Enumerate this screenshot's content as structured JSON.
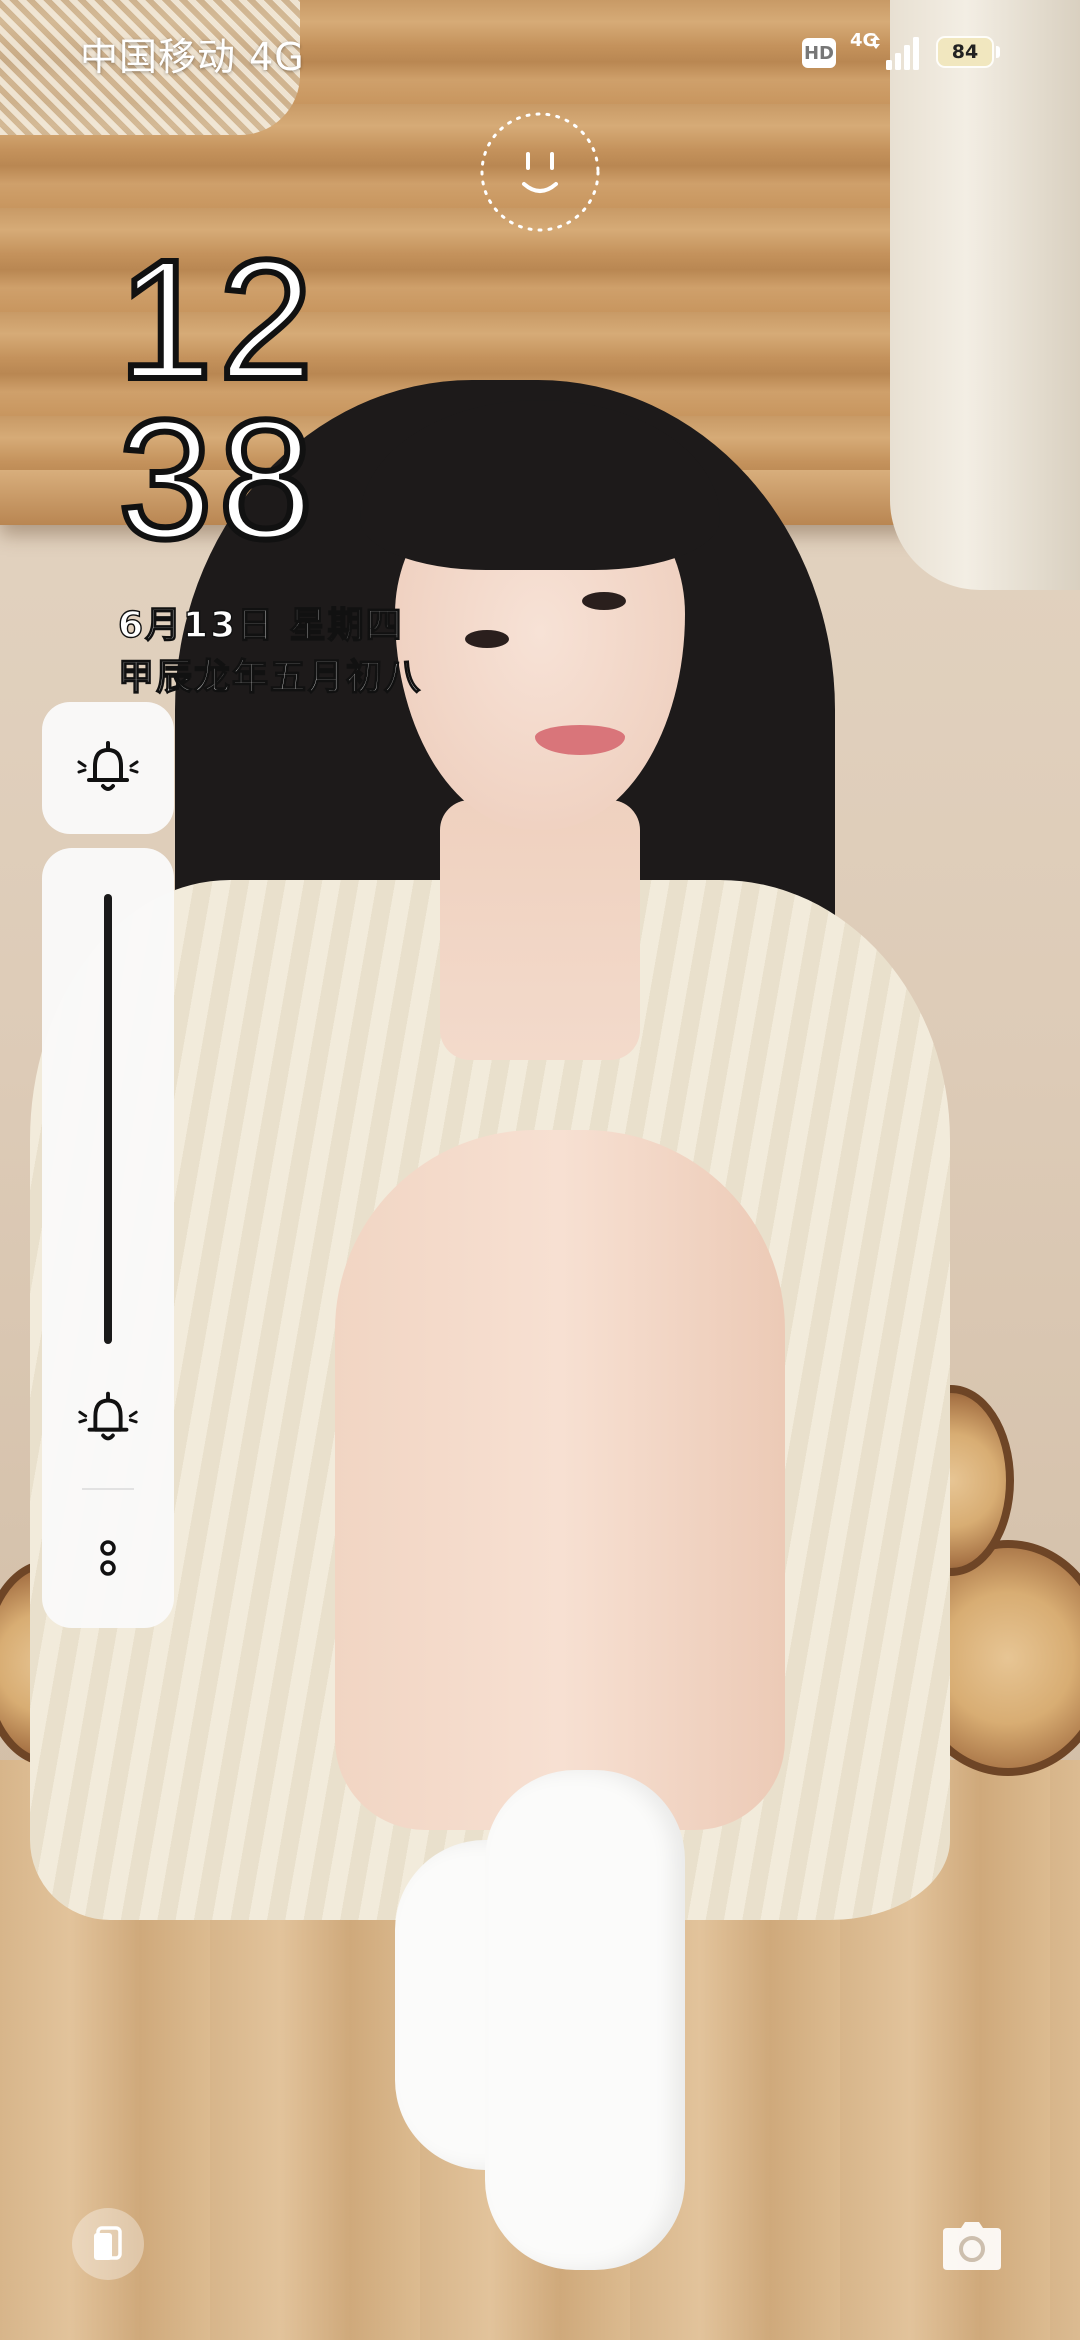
{
  "status_bar": {
    "carrier": "中国移动 4G",
    "hd_label": "HD",
    "network_type": "4G",
    "battery_level": "84",
    "signal_strength_bars": 4
  },
  "lock_screen": {
    "face_unlock_icon": "smiley-face-icon",
    "clock": {
      "hour": "12",
      "minute": "38"
    },
    "date": "6月13日  星期四",
    "lunar_date": "甲辰龙年五月初八"
  },
  "volume_controls": {
    "ring_mode_icon": "bell-ring-icon",
    "slider_icon": "bell-ring-icon",
    "more_icon": "more-vertical-icon",
    "level_percent": 100
  },
  "shortcuts": {
    "left_icon": "wallet-card-icon",
    "right_icon": "camera-icon"
  },
  "colors": {
    "panel_bg": "#fafafa",
    "battery_fill": "#f1e7bf",
    "clock_stroke": "#111111"
  }
}
